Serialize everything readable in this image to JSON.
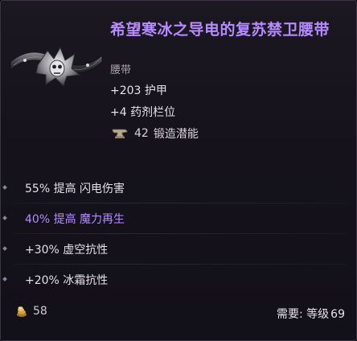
{
  "item": {
    "name": "希望寒冰之导电的复苏禁卫腰带",
    "type": "腰带",
    "name_color": "#b58bff"
  },
  "implicits": [
    {
      "text": "+203 护甲"
    },
    {
      "text": "+4 药剂栏位"
    }
  ],
  "forge": {
    "icon": "anvil-icon",
    "value": "42",
    "label": "锻造潜能"
  },
  "affixes": [
    {
      "text": "55% 提高 闪电伤害",
      "color": "#e4e0e8"
    },
    {
      "text": "40% 提高 魔力再生",
      "color": "#b38dff"
    },
    {
      "text": "+30% 虚空抗性",
      "color": "#e4e0e8"
    },
    {
      "text": "+20% 冰霜抗性",
      "color": "#e4e0e8"
    }
  ],
  "footer": {
    "gold_icon": "gold-icon",
    "gold_value": "58",
    "requirement_label": "需要: 等级",
    "requirement_value": "69"
  }
}
